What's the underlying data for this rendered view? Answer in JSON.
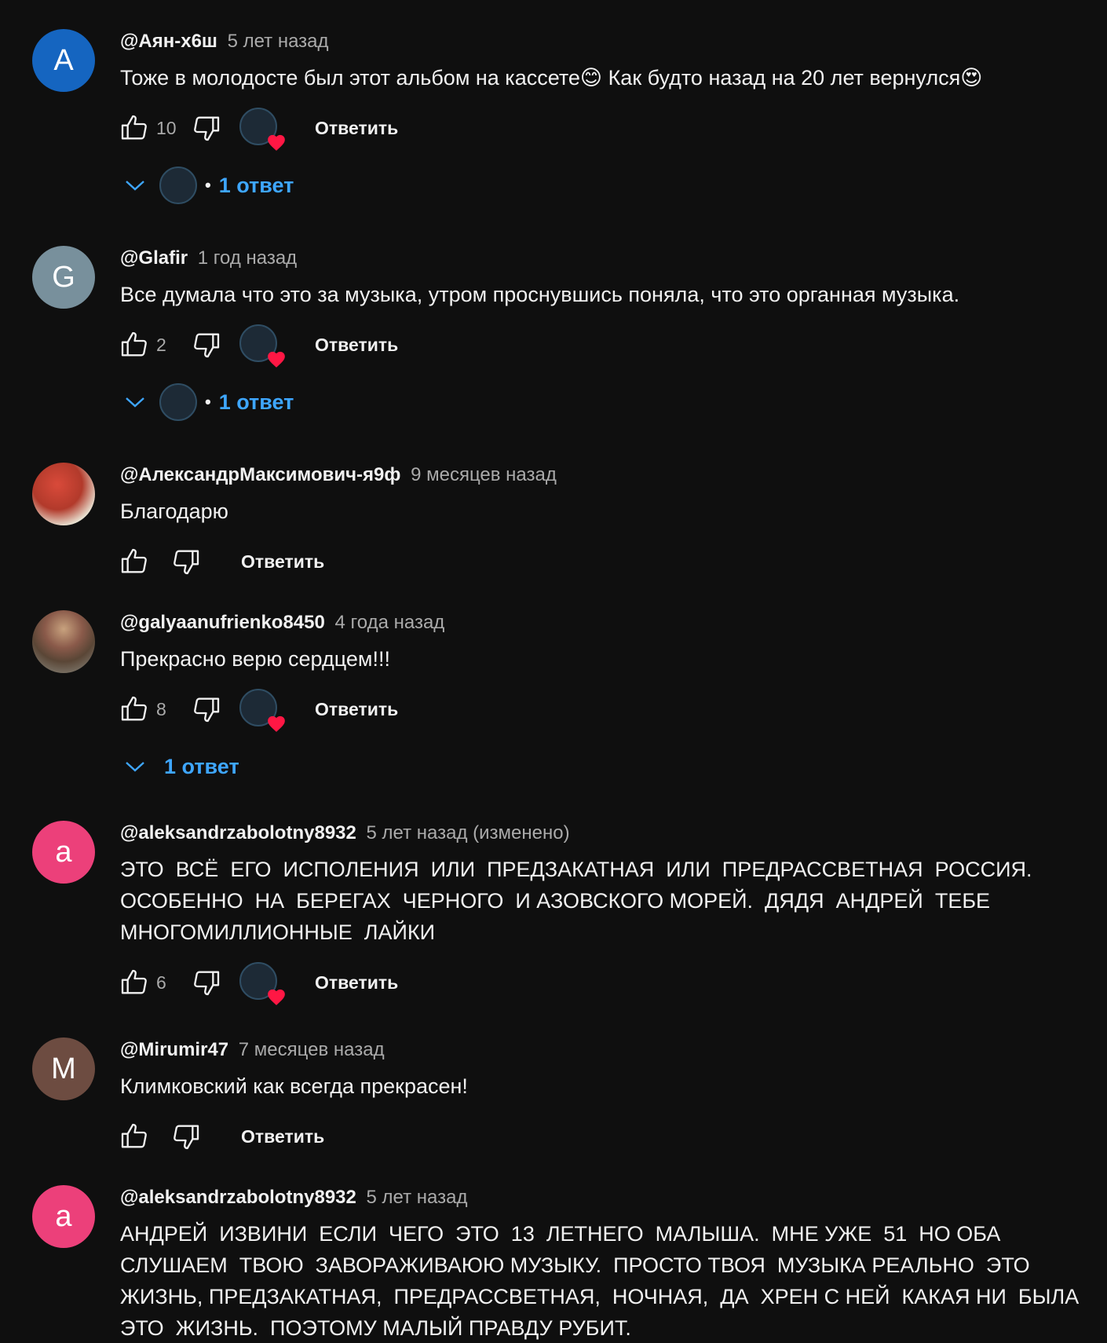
{
  "ui": {
    "reply_label": "Ответить",
    "reply_count_label": "1 ответ",
    "dot": "•"
  },
  "comments": [
    {
      "author": "@Аян-х6ш",
      "time": "5 лет назад",
      "avatar_letter": "A",
      "avatar_color": "#1565c0",
      "text": "Тоже в молодосте был этот альбом на кассете😊 Как будто назад на 20 лет вернулся😍",
      "likes": "10"
    },
    {
      "author": "@Glafir",
      "time": "1 год назад",
      "avatar_letter": "G",
      "avatar_color": "#78909c",
      "text": "Все думала что это за музыка, утром проснувшись поняла, что это органная музыка.",
      "likes": "2"
    },
    {
      "author": "@АлександрМаксимович-я9ф",
      "time": "9 месяцев назад",
      "avatar_color": "#b23a2b",
      "text": "Благодарю",
      "likes": ""
    },
    {
      "author": "@galyaanufrienko8450",
      "time": "4 года назад",
      "avatar_color": "#6d5a4a",
      "text": "Прекрасно верю сердцем!!!",
      "likes": "8"
    },
    {
      "author": "@aleksandrzabolotny8932",
      "time": "5 лет назад (изменено)",
      "avatar_letter": "a",
      "avatar_color": "#ec407a",
      "text": "ЭТО  ВСЁ  ЕГО  ИСПОЛЕНИЯ  ИЛИ  ПРЕДЗАКАТНАЯ  ИЛИ  ПРЕДРАССВЕТНАЯ  РОССИЯ.\nОСОБЕННО  НА  БЕРЕГАХ  ЧЕРНОГО  И АЗОВСКОГО МОРЕЙ.  ДЯДЯ  АНДРЕЙ  ТЕБЕ\nМНОГОМИЛЛИОННЫЕ  ЛАЙКИ",
      "likes": "6"
    },
    {
      "author": "@Mirumir47",
      "time": "7 месяцев назад",
      "avatar_letter": "M",
      "avatar_color": "#6d4c41",
      "text": "Климковский как всегда прекрасен!",
      "likes": ""
    },
    {
      "author": "@aleksandrzabolotny8932",
      "time": "5 лет назад",
      "avatar_letter": "a",
      "avatar_color": "#ec407a",
      "text": "АНДРЕЙ  ИЗВИНИ  ЕСЛИ  ЧЕГО  ЭТО  13  ЛЕТНЕГО  МАЛЫША.  МНЕ УЖЕ  51  НО ОБА\nСЛУШАЕМ  ТВОЮ  ЗАВОРАЖИВАЮЮ МУЗЫКУ.  ПРОСТО ТВОЯ  МУЗЫКА РЕАЛЬНО  ЭТО\nЖИЗНЬ, ПРЕДЗАКАТНАЯ,  ПРЕДРАССВЕТНАЯ,  НОЧНАЯ,  ДА  ХРЕН С НЕЙ  КАКАЯ НИ  БЫЛА\nЭТО  ЖИЗНЬ.  ПОЭТОМУ МАЛЫЙ ПРАВДУ РУБИТ.",
      "likes": ""
    }
  ]
}
